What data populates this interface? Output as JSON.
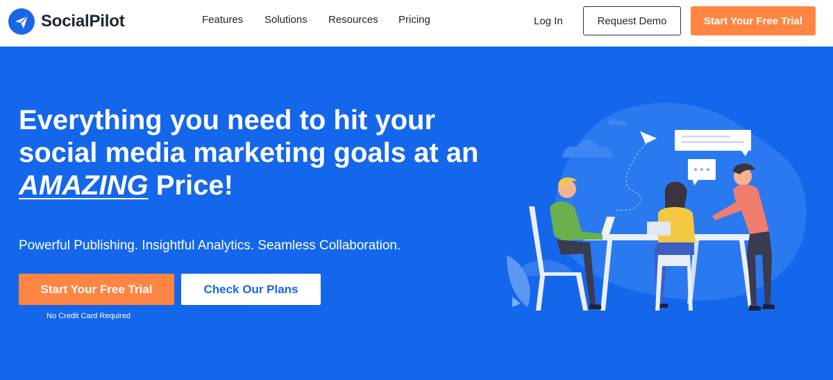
{
  "brand": {
    "name": "SocialPilot",
    "logo_icon": "paper-plane-icon",
    "accent": "#1467eb",
    "cta": "#ff8543"
  },
  "nav": {
    "items": [
      {
        "label": "Features"
      },
      {
        "label": "Solutions"
      },
      {
        "label": "Resources"
      },
      {
        "label": "Pricing"
      }
    ],
    "login": "Log In",
    "demo": "Request Demo",
    "trial": "Start Your Free Trial"
  },
  "hero": {
    "headline_line1": "Everything you need to hit your",
    "headline_line2": "social media marketing goals at an",
    "headline_em": "AMAZING",
    "headline_end": " Price!",
    "subtitle": "Powerful Publishing. Insightful Analytics. Seamless Collaboration.",
    "cta_primary": "Start Your Free Trial",
    "cta_secondary": "Check Our Plans",
    "note": "No Credit Card Required"
  }
}
